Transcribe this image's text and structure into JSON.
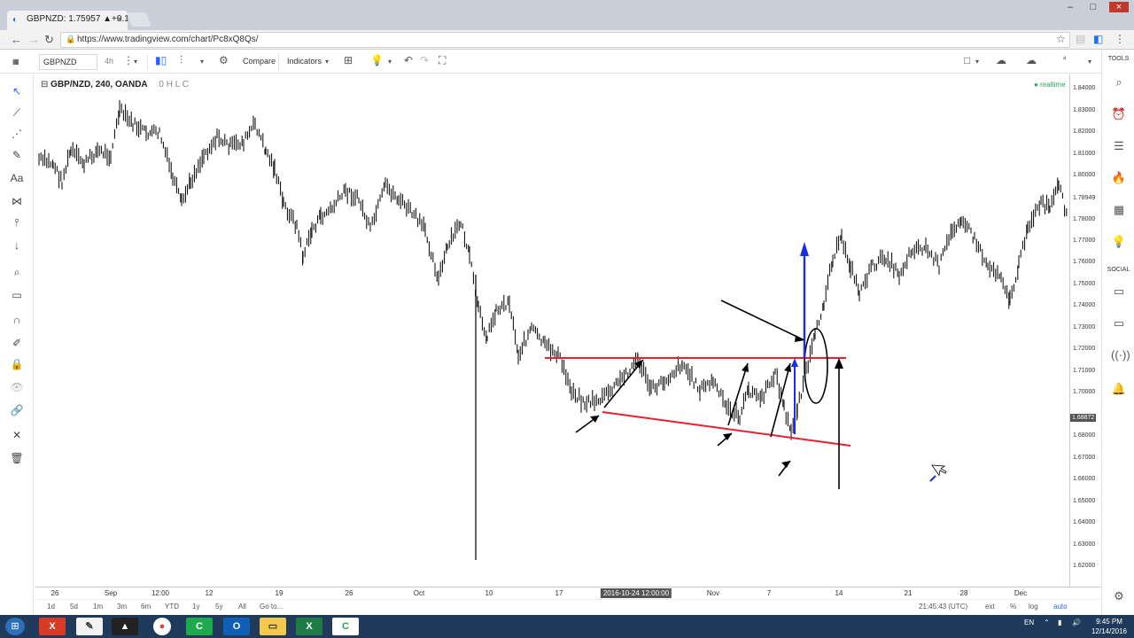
{
  "browser": {
    "tab_title": "GBPNZD: 1.75957 ▲+0.1",
    "tab_close": "×",
    "url": "https://www.tradingview.com/chart/Pc8xQ8Qs/",
    "window_buttons": [
      "–",
      "□",
      "×"
    ]
  },
  "toolbar": {
    "symbol": "GBPNZD",
    "interval": "4h",
    "compare_label": "Compare",
    "indicators_label": "Indicators",
    "tools_label": "TOOLS"
  },
  "chart": {
    "title": "GBP/NZD, 240, OANDA",
    "ohlc": "0          H          L          C",
    "realtime": "realtime",
    "current_price": "1.68872",
    "price_ticks": [
      "1.84000",
      "1.83000",
      "1.82000",
      "1.81000",
      "1.80000",
      "1.78949",
      "1.78000",
      "1.77000",
      "1.76000",
      "1.75000",
      "1.74000",
      "1.73000",
      "1.72000",
      "1.71000",
      "1.70000",
      "1.68872",
      "1.68000",
      "1.67000",
      "1.66000",
      "1.65000",
      "1.64000",
      "1.63000",
      "1.62000"
    ],
    "time_ticks": [
      "26",
      "Sep",
      "12:00",
      "12",
      "19",
      "26",
      "Oct",
      "10",
      "17",
      "Nov",
      "7",
      "14",
      "21",
      "28",
      "Dec"
    ],
    "time_cursor": "2016-10-24 12:00:00"
  },
  "bottombar": {
    "ranges": [
      "1d",
      "5d",
      "1m",
      "3m",
      "6m",
      "YTD",
      "1y",
      "5y",
      "All",
      "Go to..."
    ],
    "utc_time": "21:45:43 (UTC)",
    "right_options": [
      "ext",
      "%",
      "log",
      "auto"
    ]
  },
  "right_sidebar": {
    "social_label": "SOCIAL"
  },
  "taskbar": {
    "language": "EN",
    "time": "9:45 PM",
    "date": "12/14/2016"
  },
  "colors": {
    "red_line": "#e8202f",
    "blue_arrow": "#1a2ee8",
    "annotation": "#000000"
  }
}
